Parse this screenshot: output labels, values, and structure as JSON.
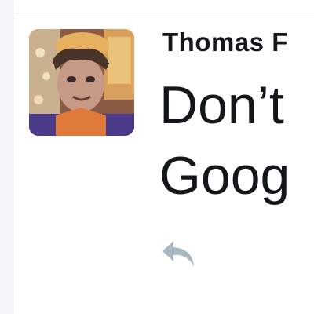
{
  "tweet": {
    "author_name": "Thomas F",
    "text_line1": "Don’t",
    "text_line2": "Goog"
  },
  "icons": {
    "avatar": "profile-photo",
    "reply": "reply-arrow-icon"
  },
  "colors": {
    "background": "#f5f8fa",
    "card": "#ffffff",
    "text": "#14171a",
    "icon": "#aab8c2"
  }
}
